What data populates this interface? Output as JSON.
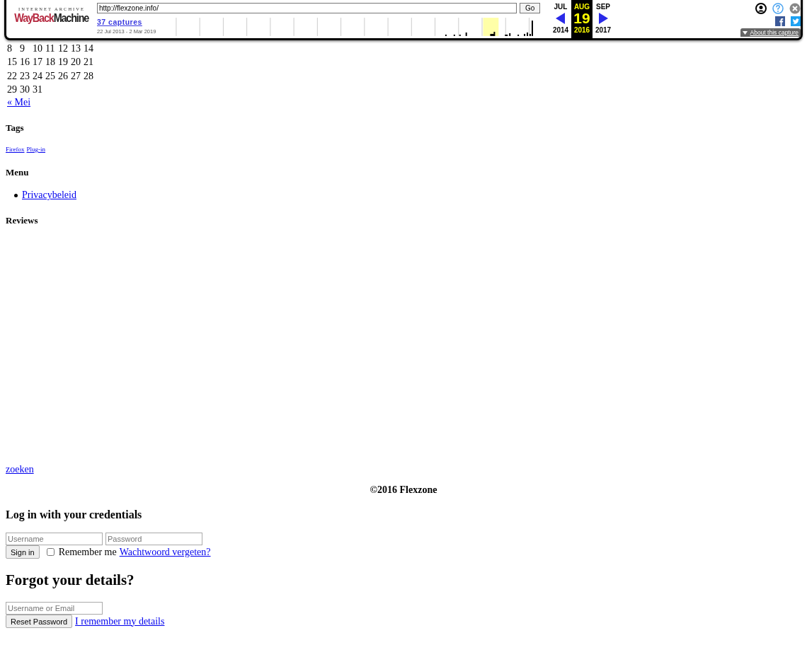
{
  "toolbar": {
    "logo_top": "INTERNET ARCHIVE",
    "logo_red": "WayBack",
    "logo_black": "Machine",
    "url": "http://flexzone.info/",
    "go": "Go",
    "captures": "37 captures",
    "range": "22 Jul 2013 - 2 Mar 2019",
    "months": [
      {
        "label": "JUL",
        "selected": false
      },
      {
        "label": "AUG",
        "selected": true
      },
      {
        "label": "SEP",
        "selected": false
      }
    ],
    "day": "19",
    "years": [
      {
        "label": "2014",
        "selected": false
      },
      {
        "label": "2016",
        "selected": true
      },
      {
        "label": "2017",
        "selected": false
      }
    ],
    "about": "About this capture"
  },
  "calendar": {
    "weeks": [
      [
        "8",
        "9",
        "10",
        "11",
        "12",
        "13",
        "14"
      ],
      [
        "15",
        "16",
        "17",
        "18",
        "19",
        "20",
        "21"
      ],
      [
        "22",
        "23",
        "24",
        "25",
        "26",
        "27",
        "28"
      ],
      [
        "29",
        "30",
        "31"
      ]
    ],
    "prev": "« Mei"
  },
  "tags": {
    "title": "Tags",
    "items": [
      "Firefox",
      "Plug-in"
    ]
  },
  "menu": {
    "title": "Menu",
    "items": [
      "Privacybeleid"
    ]
  },
  "reviews": {
    "title": "Reviews"
  },
  "search_link": "zoeken",
  "footer": "©2016 Flexzone",
  "login": {
    "title": "Log in with your credentials",
    "username_placeholder": "Username",
    "password_placeholder": "Password",
    "submit": "Sign in",
    "remember": {
      "label": "Remember me",
      "checked": false
    },
    "forgot_link": "Wachtwoord vergeten?"
  },
  "reset": {
    "title": "Forgot your details?",
    "placeholder": "Username or Email",
    "submit": "Reset Password",
    "back_link": "I remember my details"
  }
}
